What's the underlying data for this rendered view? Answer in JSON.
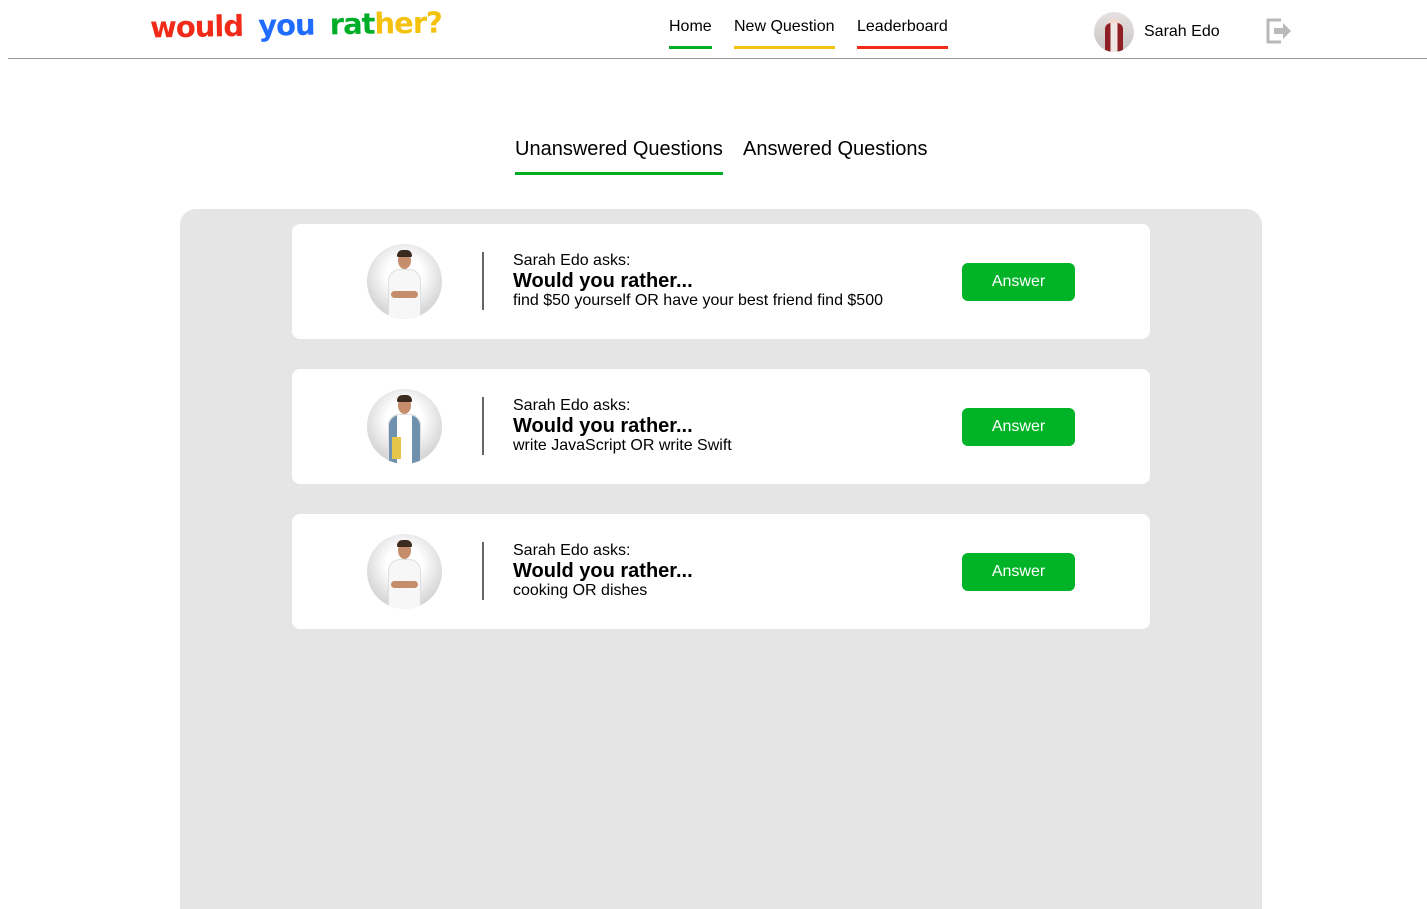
{
  "header": {
    "logo_parts": [
      "would",
      "you",
      "rat",
      "her?"
    ],
    "nav": {
      "home": "Home",
      "new_question": "New Question",
      "leaderboard": "Leaderboard"
    },
    "user_name": "Sarah Edo",
    "logout_icon": "logout-icon"
  },
  "tabs": {
    "unanswered": "Unanswered Questions",
    "answered": "Answered Questions"
  },
  "questions": [
    {
      "asker": "Sarah Edo asks:",
      "prompt": "Would you rather...",
      "options": "find $50 yourself OR have your best friend find $500",
      "button": "Answer"
    },
    {
      "asker": "Sarah Edo asks:",
      "prompt": "Would you rather...",
      "options": "write JavaScript OR write Swift",
      "button": "Answer"
    },
    {
      "asker": "Sarah Edo asks:",
      "prompt": "Would you rather...",
      "options": "cooking OR dishes",
      "button": "Answer"
    }
  ],
  "colors": {
    "red": "#f22a1a",
    "blue": "#1f6cff",
    "green": "#00ad26",
    "yellow": "#f4c20d",
    "panel_gray": "#e5e5e5"
  }
}
